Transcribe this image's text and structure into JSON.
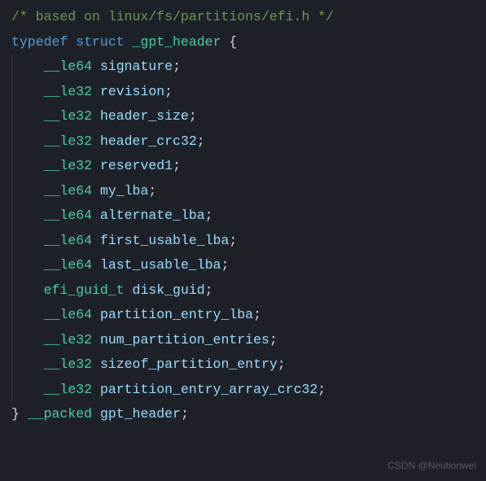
{
  "code": {
    "l0": {
      "comment": "/* based on linux/fs/partitions/efi.h */"
    },
    "l1": {
      "kw1": "typedef",
      "kw2": "struct",
      "name": "_gpt_header",
      "brace": "{"
    },
    "l2": {
      "type": "__le64",
      "ident": "signature",
      "semi": ";"
    },
    "l3": {
      "type": "__le32",
      "ident": "revision",
      "semi": ";"
    },
    "l4": {
      "type": "__le32",
      "ident": "header_size",
      "semi": ";"
    },
    "l5": {
      "type": "__le32",
      "ident": "header_crc32",
      "semi": ";"
    },
    "l6": {
      "type": "__le32",
      "ident": "reserved1",
      "semi": ";"
    },
    "l7": {
      "type": "__le64",
      "ident": "my_lba",
      "semi": ";"
    },
    "l8": {
      "type": "__le64",
      "ident": "alternate_lba",
      "semi": ";"
    },
    "l9": {
      "type": "__le64",
      "ident": "first_usable_lba",
      "semi": ";"
    },
    "l10": {
      "type": "__le64",
      "ident": "last_usable_lba",
      "semi": ";"
    },
    "l11": {
      "type": "efi_guid_t",
      "ident": "disk_guid",
      "semi": ";"
    },
    "l12": {
      "type": "__le64",
      "ident": "partition_entry_lba",
      "semi": ";"
    },
    "l13": {
      "type": "__le32",
      "ident": "num_partition_entries",
      "semi": ";"
    },
    "l14": {
      "type": "__le32",
      "ident": "sizeof_partition_entry",
      "semi": ";"
    },
    "l15": {
      "type": "__le32",
      "ident": "partition_entry_array_crc32",
      "semi": ";"
    },
    "l16": {
      "brace": "}",
      "attr": "__packed",
      "name": "gpt_header",
      "semi": ";"
    }
  },
  "watermarks": {
    "w1": "",
    "w2": "CSDN @Neutionwei"
  }
}
